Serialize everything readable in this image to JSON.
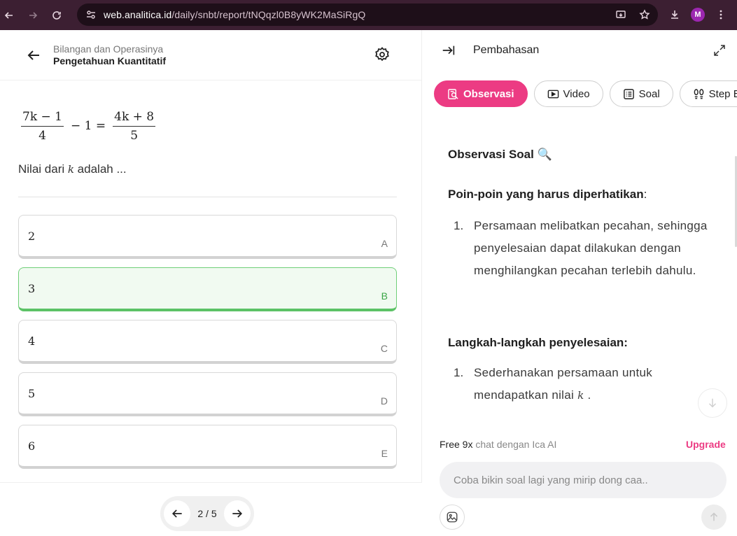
{
  "browser": {
    "url_host": "web.analitica.id",
    "url_path": "/daily/snbt/report/tNQqzl0B8yWK2MaSiRgQ",
    "profile_initial": "M"
  },
  "header": {
    "subtitle": "Bilangan dan Operasinya",
    "title": "Pengetahuan Kuantitatif"
  },
  "problem": {
    "lhs_num": "7k − 1",
    "lhs_den": "4",
    "middle": "− 1 =",
    "rhs_num": "4k + 8",
    "rhs_den": "5",
    "question_prefix": "Nilai dari ",
    "question_var": "k",
    "question_suffix": " adalah ..."
  },
  "options": [
    {
      "value": "2",
      "letter": "A"
    },
    {
      "value": "3",
      "letter": "B"
    },
    {
      "value": "4",
      "letter": "C"
    },
    {
      "value": "5",
      "letter": "D"
    },
    {
      "value": "6",
      "letter": "E"
    }
  ],
  "pager": {
    "label": "2 / 5"
  },
  "panel": {
    "title": "Pembahasan",
    "tabs": [
      {
        "label": "Observasi"
      },
      {
        "label": "Video"
      },
      {
        "label": "Soal"
      },
      {
        "label": "Step By S"
      }
    ],
    "obs_heading": "Observasi Soal 🔍",
    "poin_heading": "Poin-poin yang harus diperhatikan",
    "poin_colon": ":",
    "poin_items": [
      {
        "num": "1.",
        "text": "Persamaan melibatkan pecahan, sehingga penyelesaian dapat dilakukan dengan menghilangkan pecahan terlebih dahulu."
      }
    ],
    "langkah_heading": "Langkah-langkah penyelesaian:",
    "langkah_items": [
      {
        "num": "1.",
        "text_before": "Sederhanakan persamaan untuk mendapatkan nilai ",
        "var": "k",
        "text_after": " ."
      }
    ]
  },
  "chat": {
    "free_count": "Free 9x",
    "free_suffix": " chat dengan Ica AI",
    "upgrade": "Upgrade",
    "placeholder": "Coba bikin soal lagi yang mirip dong caa.."
  },
  "colors": {
    "accent": "#ec3b83",
    "correct": "#5cc266",
    "chrome": "#3c1f32"
  }
}
